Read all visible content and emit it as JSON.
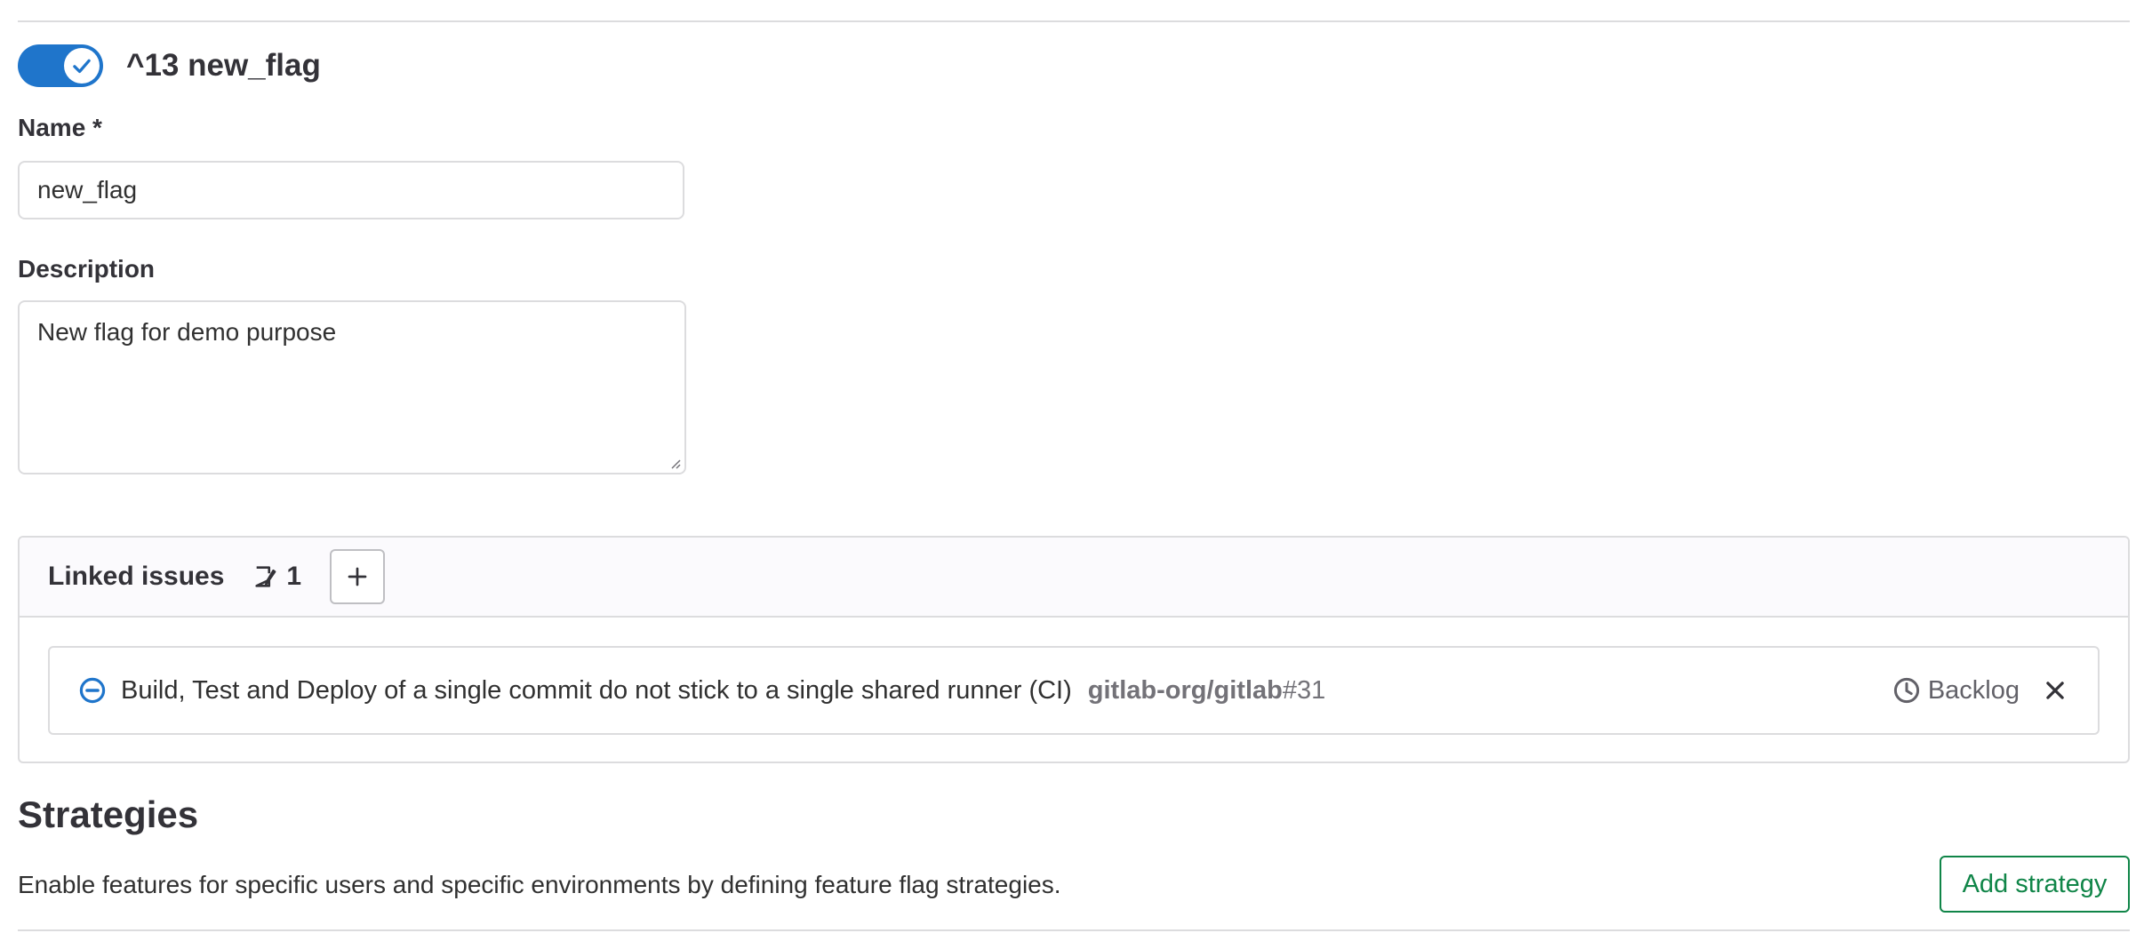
{
  "flag": {
    "enabled": true,
    "title": "^13 new_flag"
  },
  "form": {
    "name_label": "Name *",
    "name_value": "new_flag",
    "description_label": "Description",
    "description_value": "New flag for demo purpose"
  },
  "linked_issues": {
    "title": "Linked issues",
    "count": "1",
    "add_button": "+",
    "items": [
      {
        "title": "Build, Test and Deploy of a single commit do not stick to a single shared runner (CI)",
        "path": "gitlab-org/gitlab",
        "number": "#31",
        "milestone": "Backlog"
      }
    ]
  },
  "strategies": {
    "title": "Strategies",
    "description": "Enable features for specific users and specific environments by defining feature flag strategies.",
    "add_button": "Add strategy"
  },
  "colors": {
    "toggle_on": "#1f75cb",
    "confirm_green": "#108548",
    "border": "#dcdcde"
  },
  "icons": [
    "check-icon",
    "issue-icon",
    "plus-icon",
    "issue-status-icon",
    "clock-icon",
    "close-icon"
  ]
}
